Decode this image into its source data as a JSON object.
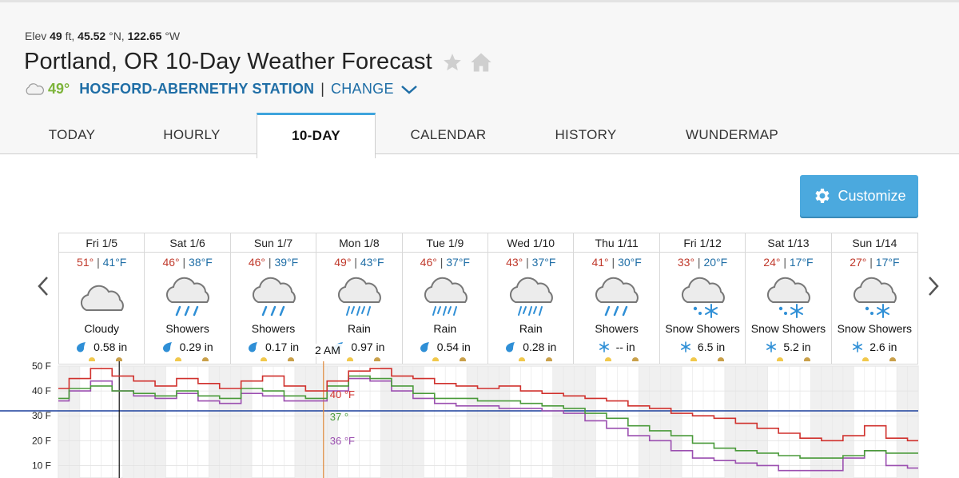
{
  "header": {
    "elev_prefix": "Elev",
    "elev_value": "49",
    "elev_unit": "ft,",
    "lat": "45.52",
    "lat_unit": "°N,",
    "lon": "122.65",
    "lon_unit": "°W",
    "title": "Portland, OR 10-Day Weather Forecast",
    "current_temp": "49°",
    "station": "HOSFORD-ABERNETHY STATION",
    "separator": "|",
    "change_label": "CHANGE"
  },
  "tabs": [
    {
      "label": "TODAY",
      "active": false
    },
    {
      "label": "HOURLY",
      "active": false
    },
    {
      "label": "10-DAY",
      "active": true
    },
    {
      "label": "CALENDAR",
      "active": false
    },
    {
      "label": "HISTORY",
      "active": false
    },
    {
      "label": "WUNDERMAP",
      "active": false
    }
  ],
  "customize_label": "Customize",
  "colors": {
    "accent": "#3fa4dd",
    "high": "#c0392b",
    "low": "#1f6ea6",
    "current": "#7db43a",
    "freezing_line": "#1a3f9c",
    "temperature": "#d0312d",
    "dew_point": "#4a9a3a",
    "feels_like": "#9b4fb0"
  },
  "days": [
    {
      "name": "Fri 1/5",
      "hi": "51°",
      "lo": "41°F",
      "icon": "cloudy",
      "cond": "Cloudy",
      "precip_icon": "raindrop-icon",
      "precip": "0.58 in"
    },
    {
      "name": "Sat 1/6",
      "hi": "46°",
      "lo": "38°F",
      "icon": "showers",
      "cond": "Showers",
      "precip_icon": "raindrop-icon",
      "precip": "0.29 in"
    },
    {
      "name": "Sun 1/7",
      "hi": "46°",
      "lo": "39°F",
      "icon": "showers",
      "cond": "Showers",
      "precip_icon": "raindrop-icon",
      "precip": "0.17 in"
    },
    {
      "name": "Mon 1/8",
      "hi": "49°",
      "lo": "43°F",
      "icon": "rain",
      "cond": "Rain",
      "precip_icon": "raindrop-icon",
      "precip": "0.97 in"
    },
    {
      "name": "Tue 1/9",
      "hi": "46°",
      "lo": "37°F",
      "icon": "rain",
      "cond": "Rain",
      "precip_icon": "raindrop-icon",
      "precip": "0.54 in"
    },
    {
      "name": "Wed 1/10",
      "hi": "43°",
      "lo": "37°F",
      "icon": "rain",
      "cond": "Rain",
      "precip_icon": "raindrop-icon",
      "precip": "0.28 in"
    },
    {
      "name": "Thu 1/11",
      "hi": "41°",
      "lo": "30°F",
      "icon": "showers",
      "cond": "Showers",
      "precip_icon": "snowflake-icon",
      "precip": "-- in"
    },
    {
      "name": "Fri 1/12",
      "hi": "33°",
      "lo": "20°F",
      "icon": "snow",
      "cond": "Snow Showers",
      "precip_icon": "snowflake-icon",
      "precip": "6.5 in"
    },
    {
      "name": "Sat 1/13",
      "hi": "24°",
      "lo": "17°F",
      "icon": "snow",
      "cond": "Snow Showers",
      "precip_icon": "snowflake-icon",
      "precip": "5.2 in"
    },
    {
      "name": "Sun 1/14",
      "hi": "27°",
      "lo": "17°F",
      "icon": "snow",
      "cond": "Snow Showers",
      "precip_icon": "snowflake-icon",
      "precip": "2.6 in"
    }
  ],
  "tooltip": {
    "time": "2 AM",
    "temperature": "40 °F",
    "dew_point": "37 °",
    "feels_like": "36 °F"
  },
  "chart_data": {
    "type": "line",
    "y_tick_labels": [
      "50 F",
      "40 F",
      "30 F",
      "20 F",
      "10 F"
    ],
    "ylim": [
      5,
      50
    ],
    "freezing_line": 32,
    "x_days": [
      "Fri 1/5",
      "Sat 1/6",
      "Sun 1/7",
      "Mon 1/8",
      "Tue 1/9",
      "Wed 1/10",
      "Thu 1/11",
      "Fri 1/12",
      "Sat 1/13",
      "Sun 1/14"
    ],
    "x_hours": [
      0,
      6,
      12,
      18,
      24,
      30,
      36,
      42,
      48,
      54,
      60,
      66,
      72,
      78,
      84,
      90,
      96,
      102,
      108,
      114,
      120,
      126,
      132,
      138,
      144,
      150,
      156,
      162,
      168,
      174,
      180,
      186,
      192,
      198,
      204,
      210,
      216,
      222,
      228,
      234,
      240
    ],
    "series": [
      {
        "key": "temperature",
        "values": [
          41,
          45,
          49,
          46,
          44,
          42,
          45,
          43,
          41,
          44,
          46,
          42,
          40,
          44,
          48,
          49,
          46,
          45,
          43,
          42,
          41,
          42,
          40,
          39,
          38,
          37,
          36,
          34,
          33,
          31,
          30,
          29,
          27,
          25,
          23,
          21,
          20,
          22,
          26,
          21,
          20
        ]
      },
      {
        "key": "dew_point",
        "values": [
          37,
          41,
          42,
          40,
          39,
          38,
          40,
          38,
          37,
          41,
          40,
          38,
          37,
          42,
          46,
          45,
          42,
          39,
          37,
          37,
          36,
          36,
          35,
          34,
          33,
          31,
          29,
          26,
          24,
          22,
          19,
          17,
          16,
          15,
          14,
          13,
          13,
          14,
          16,
          15,
          15
        ]
      },
      {
        "key": "feels_like",
        "values": [
          36,
          40,
          44,
          40,
          38,
          37,
          39,
          36,
          35,
          39,
          38,
          36,
          36,
          40,
          45,
          44,
          40,
          37,
          35,
          34,
          34,
          33,
          33,
          32,
          31,
          28,
          25,
          22,
          20,
          16,
          13,
          12,
          11,
          10,
          8,
          8,
          8,
          13,
          16,
          10,
          9
        ]
      }
    ]
  }
}
